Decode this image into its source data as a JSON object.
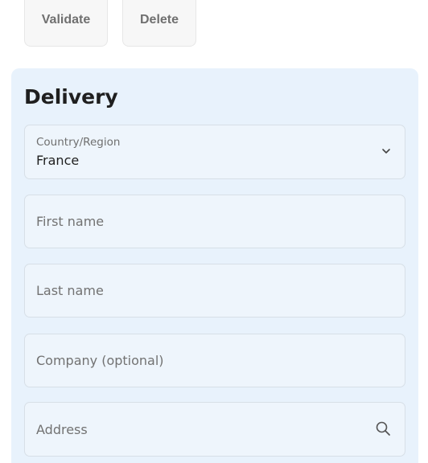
{
  "actions": {
    "validate_label": "Validate",
    "delete_label": "Delete"
  },
  "delivery": {
    "title": "Delivery",
    "country": {
      "label": "Country/Region",
      "value": "France",
      "icon": "chevron-down-icon"
    },
    "first_name": {
      "placeholder": "First name",
      "value": ""
    },
    "last_name": {
      "placeholder": "Last name",
      "value": ""
    },
    "company": {
      "placeholder": "Company (optional)",
      "value": ""
    },
    "address": {
      "placeholder": "Address",
      "value": "",
      "icon": "search-icon"
    }
  },
  "colors": {
    "card_background": "#e8f2fc",
    "field_border": "#d7dfe7",
    "text": "#1f1f1f",
    "muted_text": "#707070"
  }
}
